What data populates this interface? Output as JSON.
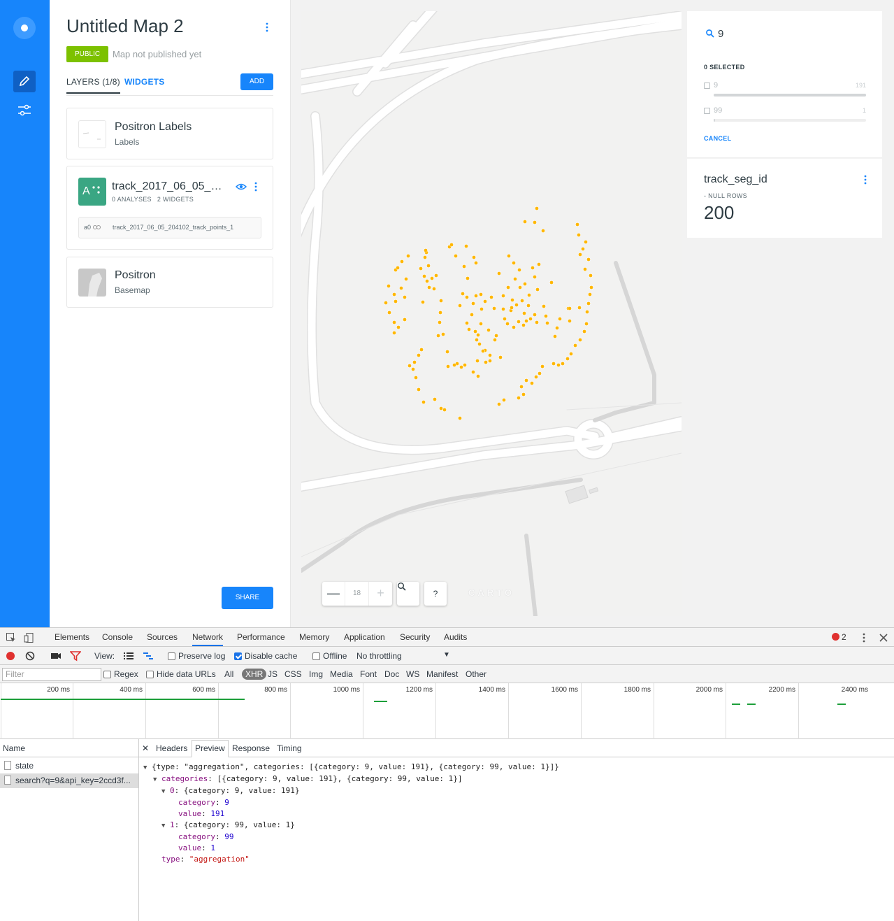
{
  "editor": {
    "map_title": "Untitled Map 2",
    "privacy_badge": "PUBLIC",
    "publish_status": "Map not published yet",
    "tabs": [
      "LAYERS (1/8)",
      "WIDGETS"
    ],
    "add_button": "ADD",
    "share_button": "SHARE",
    "layers": [
      {
        "name": "Positron Labels",
        "type": "Labels",
        "thumb": "labels-thumbnail"
      },
      {
        "name": "track_2017_06_05_204102_track_points_1",
        "letter": "A",
        "analyses": "0 ANALYSES",
        "widgets": "2 WIDGETS",
        "node_id": "a0",
        "source": "track_2017_06_05_204102_track_points_1",
        "color": "#3aa683"
      },
      {
        "name": "Positron",
        "type": "Basemap",
        "thumb": "basemap-thumbnail"
      }
    ]
  },
  "rail": {
    "items": [
      "carto-logo-icon",
      "edit-pencil-icon",
      "filters-icon"
    ],
    "accent": "#1785fb"
  },
  "map": {
    "zoom_minus": "—",
    "zoom_level": "18",
    "zoom_plus": "+",
    "search_icon": "search-icon",
    "help_label": "?",
    "attribution_logo": "CARTO",
    "point_color": "#ffb700"
  },
  "category_widget": {
    "search_query": "9",
    "selected_count": "0 SELECTED",
    "categories": [
      {
        "name": "9",
        "value": "191",
        "fraction": 1.0
      },
      {
        "name": "99",
        "value": "1",
        "fraction": 0.005
      }
    ],
    "cancel_label": "CANCEL"
  },
  "formula_widget": {
    "title": "track_seg_id",
    "nulls": "- NULL ROWS",
    "value": "200"
  },
  "devtools": {
    "tabs": [
      "Elements",
      "Console",
      "Sources",
      "Network",
      "Performance",
      "Memory",
      "Application",
      "Security",
      "Audits"
    ],
    "error_count": "2",
    "toolbar": {
      "view_label": "View:",
      "preserve_log": "Preserve log",
      "disable_cache": "Disable cache",
      "offline": "Offline",
      "throttling": "No throttling"
    },
    "filter_bar": {
      "filter_placeholder": "Filter",
      "regex": "Regex",
      "hide_data_urls": "Hide data URLs",
      "types": [
        "All",
        "XHR",
        "JS",
        "CSS",
        "Img",
        "Media",
        "Font",
        "Doc",
        "WS",
        "Manifest",
        "Other"
      ]
    },
    "timeline_ticks": [
      "200 ms",
      "400 ms",
      "600 ms",
      "800 ms",
      "1000 ms",
      "1200 ms",
      "1400 ms",
      "1600 ms",
      "1800 ms",
      "2000 ms",
      "2200 ms",
      "2400 ms"
    ],
    "requests_header": "Name",
    "requests": [
      "state",
      "search?q=9&api_key=2ccd3f..."
    ],
    "detail_tabs": [
      "Headers",
      "Preview",
      "Response",
      "Timing"
    ],
    "preview_lines": {
      "root": "{type: \"aggregation\", categories: [{category: 9, value: 191}, {category: 99, value: 1}]}",
      "categories_key": "categories",
      "categories_summary": "[{category: 9, value: 191}, {category: 99, value: 1}]",
      "item0_key": "0",
      "item0_summary": "{category: 9, value: 191}",
      "item1_key": "1",
      "item1_summary": "{category: 99, value: 1}",
      "category_key": "category",
      "value_key": "value",
      "item0_category": "9",
      "item0_value": "191",
      "item1_category": "99",
      "item1_value": "1",
      "type_key": "type",
      "type_value": "\"aggregation\""
    }
  }
}
